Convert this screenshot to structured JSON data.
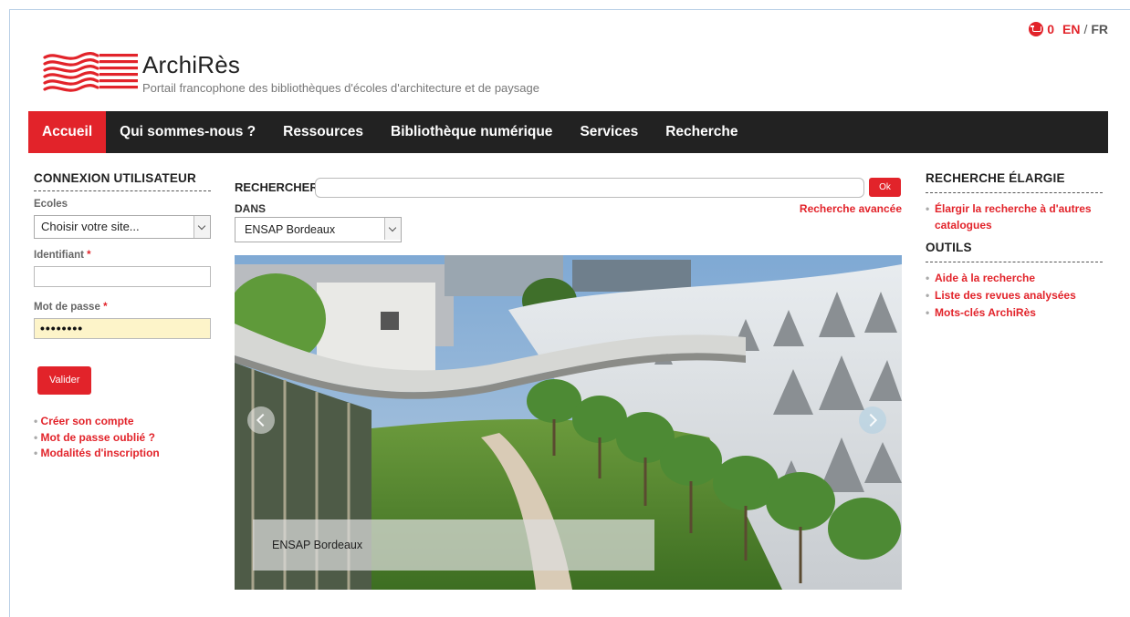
{
  "header": {
    "site_name": "ArchiRès",
    "tagline": "Portail francophone des bibliothèques d'écoles d'architecture et de paysage",
    "cart_count": "0",
    "lang_en": "EN",
    "lang_sep": "/",
    "lang_fr": "FR"
  },
  "nav": {
    "items": [
      {
        "label": "Accueil",
        "active": true
      },
      {
        "label": "Qui sommes-nous ?"
      },
      {
        "label": "Ressources"
      },
      {
        "label": "Bibliothèque numérique"
      },
      {
        "label": "Services"
      },
      {
        "label": "Recherche"
      }
    ]
  },
  "login": {
    "title": "CONNEXION UTILISATEUR",
    "ecoles_label": "Ecoles",
    "ecoles_value": "Choisir votre site...",
    "identifiant_label": "Identifiant",
    "password_label": "Mot de passe",
    "required_mark": "*",
    "password_value": "••••••••",
    "submit": "Valider",
    "links": [
      "Créer son compte",
      "Mot de passe oublié ?",
      "Modalités d'inscription"
    ]
  },
  "search": {
    "label": "RECHERCHER",
    "ok": "Ok",
    "dans_label": "DANS",
    "dans_value": "ENSAP Bordeaux",
    "advanced": "Recherche avancée"
  },
  "slide": {
    "caption": "ENSAP Bordeaux"
  },
  "sidebar": {
    "recherche_title": "RECHERCHE ÉLARGIE",
    "recherche_links": [
      "Élargir la recherche à d'autres catalogues"
    ],
    "outils_title": "OUTILS",
    "outils_links": [
      "Aide à la recherche",
      "Liste des revues analysées",
      "Mots-clés ArchiRès"
    ]
  },
  "colors": {
    "accent": "#e2232a",
    "nav_bg": "#222222"
  }
}
